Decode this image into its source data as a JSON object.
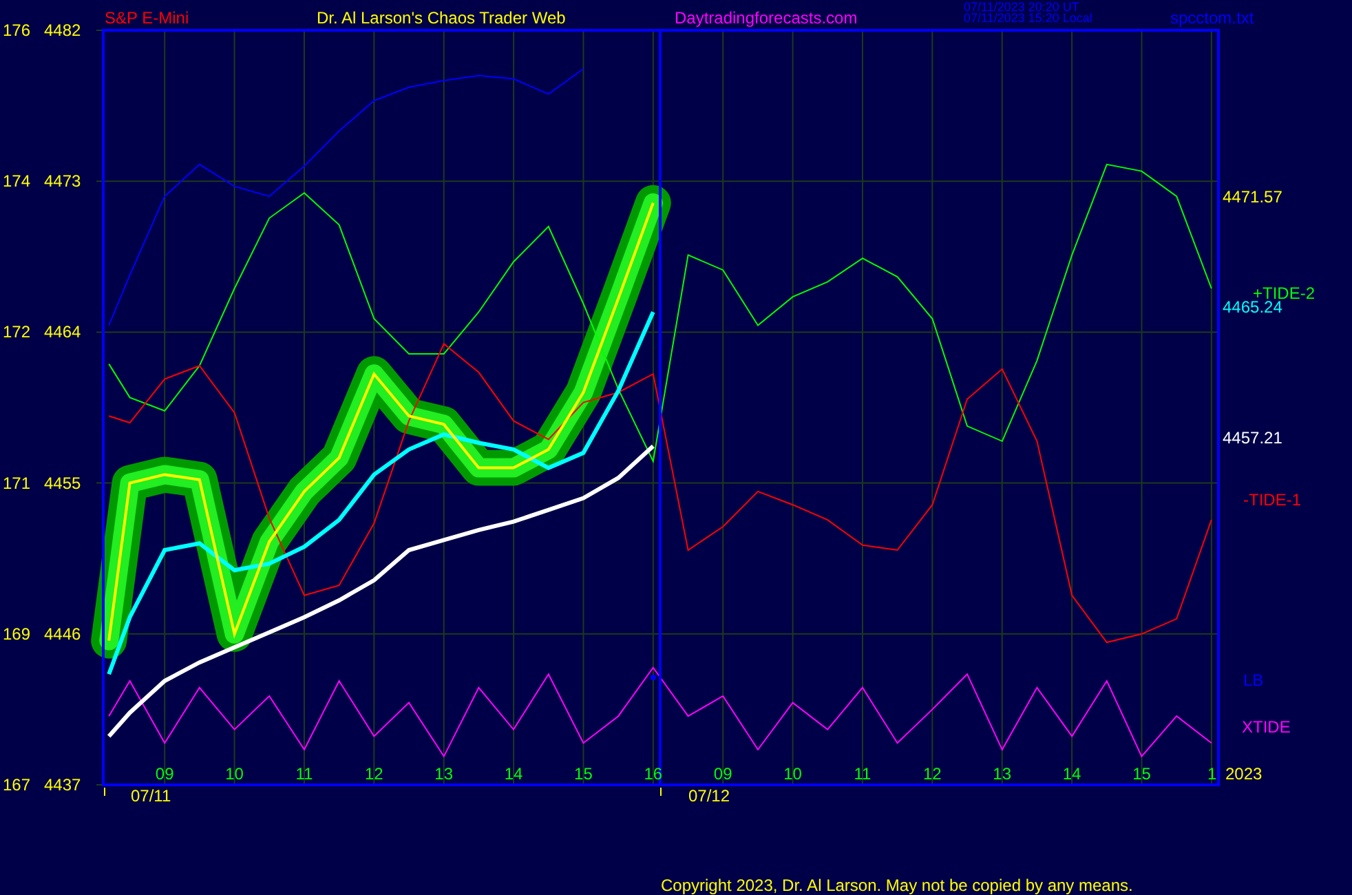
{
  "header": {
    "symbol": "S&P E-Mini",
    "title": "Dr. Al Larson's Chaos Trader Web",
    "site": "Daytradingforecasts.com",
    "timestamps": [
      "07/11/2023 20:20 UT",
      "07/11/2023 15:20 Local"
    ],
    "file": "spcctom.txt"
  },
  "chart": {
    "cycle_labels": [
      "176",
      "174",
      "172",
      "171",
      "169",
      "167"
    ],
    "forecast_hours": [
      "09",
      "10",
      "11",
      "12",
      "13",
      "14",
      "15",
      "1"
    ],
    "dates": [
      "07/11",
      "07/12"
    ],
    "right_labels": [
      {
        "text": "4471.57",
        "color": "#ffff00"
      },
      {
        "text": "4465.24",
        "color": "#00ffff"
      },
      {
        "text": "4457.21",
        "color": "#ffffff"
      },
      {
        "text": "2023",
        "color": "#ffff00"
      }
    ],
    "chart_data": {
      "type": "line",
      "grid": true,
      "ref_lines": [
        {
          "axis": "x",
          "value": 16.1,
          "color": "#0000ff"
        }
      ],
      "xlim": [
        8.12,
        24.1
      ],
      "ylim": [
        4437,
        4482
      ],
      "yticks": [
        4482,
        4473,
        4464,
        4455,
        4446,
        4437
      ],
      "xticks": [
        {
          "value": 9,
          "label": "09"
        },
        {
          "value": 10,
          "label": "10"
        },
        {
          "value": 11,
          "label": "11"
        },
        {
          "value": 12,
          "label": "12"
        },
        {
          "value": 13,
          "label": "13"
        },
        {
          "value": 14,
          "label": "14"
        },
        {
          "value": 15,
          "label": "15"
        },
        {
          "value": 16,
          "label": "16"
        }
      ],
      "x": [
        8.2,
        8.5,
        9,
        9.5,
        10,
        10.5,
        11,
        11.5,
        12,
        12.5,
        13,
        13.5,
        14,
        14.5,
        15,
        15.5,
        16,
        16.5,
        17,
        17.5,
        18,
        18.5,
        19,
        19.5,
        20,
        20.5,
        21,
        21.5,
        22,
        22.5,
        23,
        23.5,
        24
      ],
      "series": [
        {
          "color": "#ffff00",
          "values": [
            4445.6,
            4455.0,
            4455.5,
            4455.2,
            4446.0,
            4451.5,
            4454.5,
            4456.5,
            4461.5,
            4459.0,
            4458.5,
            4455.9,
            4455.9,
            4457.0,
            4460.4,
            4466.0,
            4471.7,
            null,
            null,
            null,
            null,
            null,
            null,
            null,
            null,
            null,
            null,
            null,
            null,
            null,
            null,
            null,
            null
          ]
        },
        {
          "color": "#00ffff",
          "values": [
            4443.6,
            4447.0,
            4451.0,
            4451.4,
            4449.8,
            4450.2,
            4451.2,
            4452.8,
            4455.5,
            4457.0,
            4457.9,
            4457.4,
            4457.0,
            4455.9,
            4456.8,
            4460.5,
            4465.2,
            null,
            null,
            null,
            null,
            null,
            null,
            null,
            null,
            null,
            null,
            null,
            null,
            null,
            null,
            null,
            null
          ]
        },
        {
          "color": "#ffffff",
          "values": [
            4439.9,
            4441.3,
            4443.2,
            4444.3,
            4445.2,
            4446.1,
            4447.0,
            4448.0,
            4449.2,
            4451.0,
            4451.6,
            4452.2,
            4452.7,
            4453.4,
            4454.1,
            4455.3,
            4457.2,
            null,
            null,
            null,
            null,
            null,
            null,
            null,
            null,
            null,
            null,
            null,
            null,
            null,
            null,
            null,
            null
          ]
        },
        {
          "name": "+TIDE-2",
          "color": "#00ff00",
          "values": [
            4462.1,
            4460.1,
            4459.3,
            4462.0,
            4466.6,
            4470.8,
            4472.3,
            4470.4,
            4464.8,
            4462.7,
            4462.7,
            4465.2,
            4468.2,
            4470.3,
            4465.7,
            4460.6,
            4456.3,
            4468.6,
            4467.7,
            4464.4,
            4466.1,
            4467.0,
            4468.4,
            4467.3,
            4464.8,
            4458.4,
            4457.5,
            4462.3,
            4468.6,
            4474.0,
            4473.6,
            4472.1,
            4466.6
          ]
        },
        {
          "name": "-TIDE-1",
          "color": "#ff0000",
          "values": [
            4459.0,
            4458.6,
            4461.2,
            4462.0,
            4459.2,
            4452.9,
            4448.3,
            4448.9,
            4452.6,
            4458.7,
            4463.3,
            4461.6,
            4458.7,
            4457.6,
            4459.8,
            4460.4,
            4461.5,
            4451.0,
            4452.4,
            4454.5,
            4453.7,
            4452.8,
            4451.3,
            4451.0,
            4453.7,
            4460.0,
            4461.8,
            4457.5,
            4448.3,
            4445.5,
            4446.0,
            4446.9,
            4452.8
          ]
        },
        {
          "name": "LB",
          "color": "#0000ff",
          "values": [
            4464.4,
            4467.4,
            4472.1,
            4474.0,
            4472.7,
            4472.1,
            4473.9,
            4476.0,
            4477.8,
            4478.6,
            4479.0,
            4479.3,
            4479.1,
            4478.2,
            4479.7,
            null,
            4443.4,
            null,
            null,
            null,
            null,
            null,
            null,
            null,
            null,
            null,
            null,
            null,
            null,
            null,
            null,
            null,
            null
          ]
        },
        {
          "name": "XTIDE",
          "color": "#ff00ff",
          "values": [
            4441.1,
            4443.2,
            4439.5,
            4442.8,
            4440.3,
            4442.3,
            4439.1,
            4443.2,
            4439.9,
            4441.9,
            4438.7,
            4442.8,
            4440.3,
            4443.6,
            4439.5,
            4441.1,
            4444.0,
            4441.1,
            4442.3,
            4439.1,
            4441.9,
            4440.3,
            4442.8,
            4439.5,
            4441.5,
            4443.6,
            4439.1,
            4442.8,
            4439.9,
            4443.2,
            4438.7,
            4441.1,
            4439.5
          ]
        }
      ]
    }
  },
  "copyright": "Copyright 2023, Dr. Al Larson. May not be copied by any means."
}
